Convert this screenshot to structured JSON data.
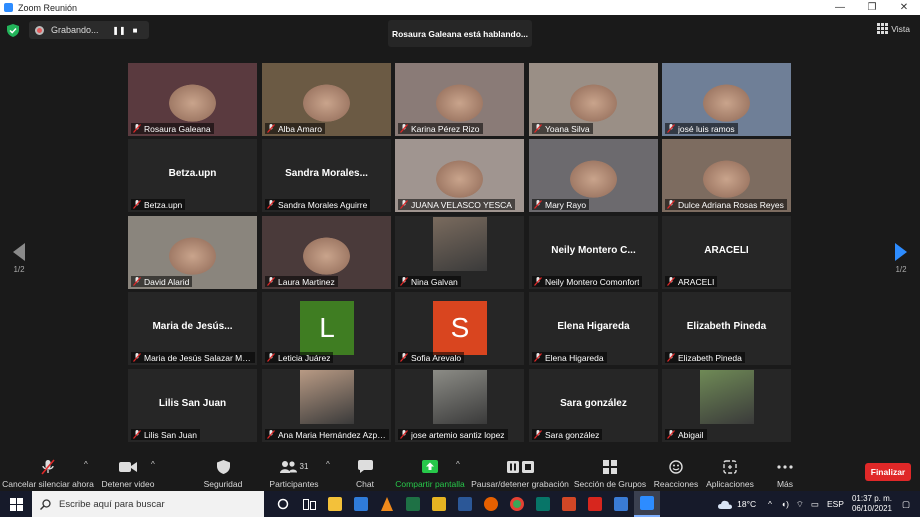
{
  "window": {
    "title": "Zoom Reunión",
    "minimize": "—",
    "restore": "❐",
    "close": "✕"
  },
  "recording": {
    "status": "Grabando...",
    "pause_icon": "pause-icon",
    "stop_icon": "stop-icon"
  },
  "speaking_banner": "Rosaura Galeana está hablando...",
  "view_button": "Vista",
  "pagination": {
    "left": "1/2",
    "right": "1/2"
  },
  "participants": [
    {
      "name": "Rosaura Galeana",
      "kind": "video",
      "bg": "#5a3a3f",
      "active": true
    },
    {
      "name": "Alba Amaro",
      "kind": "video",
      "bg": "#6b5a44"
    },
    {
      "name": "Karina Pérez Rizo",
      "kind": "video",
      "bg": "#8a7b77"
    },
    {
      "name": "Yoana Silva",
      "kind": "video",
      "bg": "#9a8f86"
    },
    {
      "name": "josé luis ramos",
      "kind": "video",
      "bg": "#6f7f97"
    },
    {
      "name": "Betza.upn",
      "kind": "name",
      "display": "Betza.upn"
    },
    {
      "name": "Sandra Morales Aguirre",
      "kind": "name",
      "display": "Sandra  Morales..."
    },
    {
      "name": "JUANA VELASCO YESCA",
      "kind": "video",
      "bg": "#a09590"
    },
    {
      "name": "Mary Rayo",
      "kind": "video",
      "bg": "#6c6a6e"
    },
    {
      "name": "Dulce Adriana Rosas Reyes",
      "kind": "video",
      "bg": "#7d6c60"
    },
    {
      "name": "David Alarid",
      "kind": "video",
      "bg": "#8a857d"
    },
    {
      "name": "Laura Martinez",
      "kind": "video",
      "bg": "#4a3a3a"
    },
    {
      "name": "Nina Galvan",
      "kind": "picture",
      "bg": "#7a6b5e"
    },
    {
      "name": "Neily Montero Comonfort",
      "kind": "name",
      "display": "Neily Montero C..."
    },
    {
      "name": "ARACELI",
      "kind": "name",
      "display": "ARACELI"
    },
    {
      "name": "Maria de Jesús Salazar Mu...",
      "kind": "name",
      "display": "Maria de Jesús..."
    },
    {
      "name": "Leticia Juárez",
      "kind": "avatar",
      "letter": "L",
      "color": "#3f7d22"
    },
    {
      "name": "Sofia Arevalo",
      "kind": "avatar",
      "letter": "S",
      "color": "#d9451f"
    },
    {
      "name": "Elena Higareda",
      "kind": "name",
      "display": "Elena Higareda"
    },
    {
      "name": "Elizabeth Pineda",
      "kind": "name",
      "display": "Elizabeth Pineda"
    },
    {
      "name": "Lilis San Juan",
      "kind": "name",
      "display": "Lilis San Juan"
    },
    {
      "name": "Ana Maria Hernández Azpi...",
      "kind": "picture",
      "bg": "#b89a84"
    },
    {
      "name": "jose artemio santiz lopez",
      "kind": "picture",
      "bg": "#8c8c86"
    },
    {
      "name": "Sara  gonzález",
      "kind": "name",
      "display": "Sara  gonzález"
    },
    {
      "name": "Abigail",
      "kind": "picture",
      "bg": "#6f8a56"
    }
  ],
  "toolbar": {
    "unmute": "Cancelar silenciar ahora",
    "stop_video": "Detener video",
    "security": "Seguridad",
    "participants": "Participantes",
    "participants_count": "31",
    "chat": "Chat",
    "share": "Compartir pantalla",
    "recording": "Pausar/detener grabación",
    "breakout": "Sección de Grupos",
    "reactions": "Reacciones",
    "apps": "Aplicaciones",
    "more": "Más",
    "end": "Finalizar"
  },
  "taskbar": {
    "search_placeholder": "Escribe aquí para buscar",
    "temperature": "18°C",
    "language": "ESP",
    "time": "01:37 p. m.",
    "date": "06/10/2021"
  },
  "colors": {
    "accent": "#2d8cff",
    "active_speaker": "#e8e77a",
    "end_button": "#e02828",
    "share_green": "#27c84a"
  }
}
